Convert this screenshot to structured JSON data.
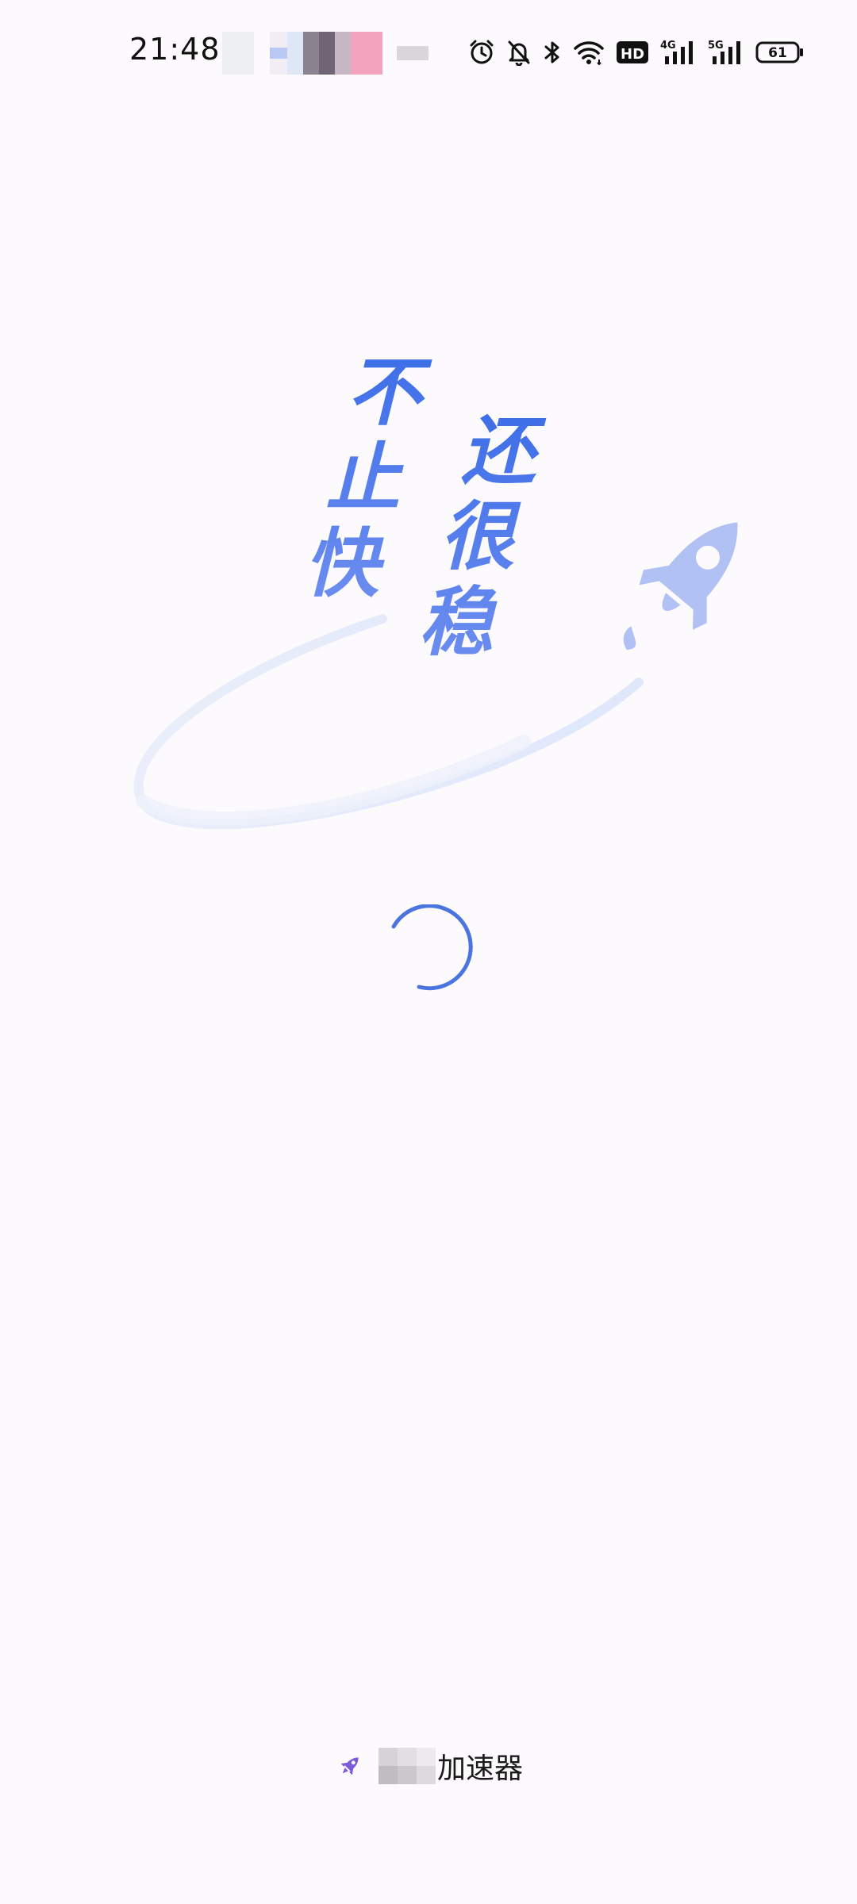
{
  "status_bar": {
    "time": "21:48",
    "battery_level": "61",
    "icons": [
      "alarm-icon",
      "bell-off-icon",
      "bluetooth-icon",
      "wifi-icon",
      "hd-icon",
      "signal-4g-icon",
      "signal-5g-icon",
      "battery-icon"
    ],
    "network_labels": {
      "hd": "HD",
      "lte": "4G",
      "nr": "5G"
    }
  },
  "hero": {
    "slogan_left": [
      "不",
      "止",
      "快"
    ],
    "slogan_right": [
      "还",
      "很",
      "稳"
    ],
    "accent_color": "#3d6ee8",
    "rocket_color": "#b1c1f4",
    "orbit_color": "#e8edf9"
  },
  "loading": {
    "spinner_color": "#4a74df"
  },
  "footer": {
    "brand_suffix": "加速器",
    "brand_icon": "rocket-icon",
    "brand_icon_color": "#7a5ad8"
  }
}
